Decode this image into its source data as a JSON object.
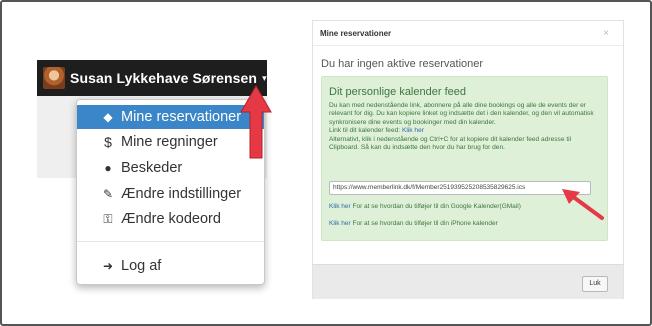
{
  "topbar": {
    "user_name": "Susan Lykkehave Sørensen",
    "caret": "▾"
  },
  "menu": {
    "items": [
      {
        "label": "Mine reservationer",
        "icon": "tag-icon",
        "glyph": "◆"
      },
      {
        "label": "Mine regninger",
        "icon": "dollar-icon",
        "glyph": "$"
      },
      {
        "label": "Beskeder",
        "icon": "comments-icon",
        "glyph": "●"
      },
      {
        "label": "Ændre indstillinger",
        "icon": "edit-icon",
        "glyph": "✎"
      },
      {
        "label": "Ændre kodeord",
        "icon": "key-icon",
        "glyph": "⚿"
      },
      {
        "label": "Log af",
        "icon": "sign-out-icon",
        "glyph": "➜"
      }
    ]
  },
  "modal": {
    "title": "Mine reservationer",
    "close_glyph": "×",
    "no_reservations": "Du har ingen aktive reservationer",
    "feed": {
      "title": "Dit personlige kalender feed",
      "desc1": "Du kan med nedenstående link, abonnere på alle dine bookings og alle de events der er relevant for dig. Du kan kopiere linket og indsætte det i den kalender, og den vil automatisk synkronisere dine events og bookinger med din kalender.",
      "link_label": "Link til dit kalender feed:",
      "link_text": "Klik her",
      "desc2": "Alternativt, klik i nedenstående og Ctrl+C for at kopiere dit kalender feed adresse til Clipboard. Så kan du indsætte den hvor du har brug for den.",
      "url": "https://www.memberlink.dk/f/Member2519395252085358296​25.ics",
      "google_link": "Klik her",
      "google_text": "For at se hvordan du tilføjer til din Google Kalender(GMail)",
      "iphone_link": "Klik her",
      "iphone_text": "For at se hvordan du tilføjer til din iPhone kalender"
    },
    "close_button": "Luk"
  },
  "colors": {
    "topbar": "#1e1e1e",
    "active_item": "#3a86c8",
    "feed_bg": "#dff0d8",
    "feed_text": "#3c763d",
    "annotation_arrow": "#e53945"
  }
}
